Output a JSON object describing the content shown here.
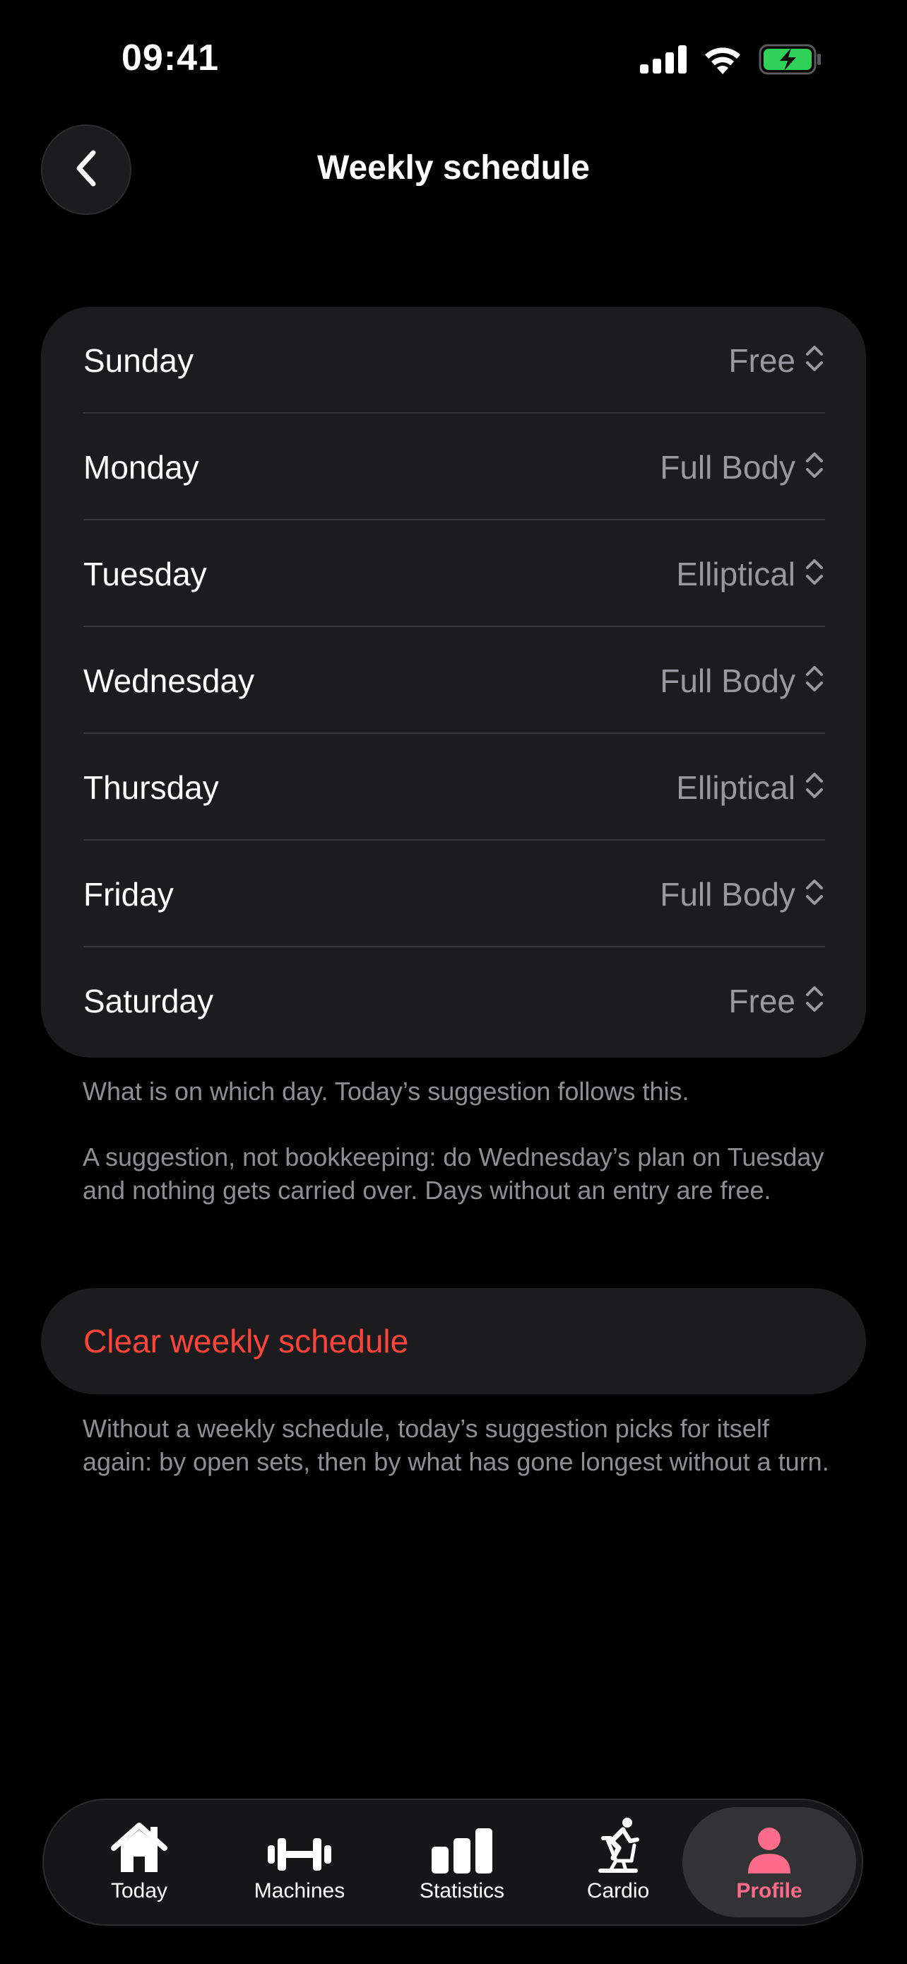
{
  "status_bar": {
    "time": "09:41",
    "icons": [
      "cellular-signal-icon",
      "wifi-icon",
      "battery-charging-icon"
    ]
  },
  "nav": {
    "back_icon": "chevron-left-icon",
    "title": "Weekly schedule"
  },
  "schedule": {
    "days": [
      {
        "day": "Sunday",
        "value": "Free"
      },
      {
        "day": "Monday",
        "value": "Full Body"
      },
      {
        "day": "Tuesday",
        "value": "Elliptical"
      },
      {
        "day": "Wednesday",
        "value": "Full Body"
      },
      {
        "day": "Thursday",
        "value": "Elliptical"
      },
      {
        "day": "Friday",
        "value": "Full Body"
      },
      {
        "day": "Saturday",
        "value": "Free"
      }
    ],
    "picker_icon": "chevron-up-down-icon"
  },
  "footnotes": {
    "note1": "What is on which day. Today’s suggestion follows this.",
    "note2": "A suggestion, not bookkeeping: do Wednesday’s plan on Tuesday and nothing gets carried over. Days without an entry are free.",
    "note3": "Without a weekly schedule, today’s suggestion picks for itself again: by open sets, then by what has gone longest without a turn."
  },
  "actions": {
    "clear_label": "Clear weekly schedule"
  },
  "tab_bar": {
    "tabs": [
      {
        "label": "Today",
        "icon": "house-icon"
      },
      {
        "label": "Machines",
        "icon": "dumbbell-icon"
      },
      {
        "label": "Statistics",
        "icon": "bar-chart-icon"
      },
      {
        "label": "Cardio",
        "icon": "stationary-bike-icon"
      },
      {
        "label": "Profile",
        "icon": "person-icon"
      }
    ],
    "active": "Profile"
  },
  "colors": {
    "background": "#000000",
    "card": "#1c1c1e",
    "secondary_text": "#98989f",
    "destructive": "#ff453a",
    "accent": "#ff6b8a",
    "battery_green": "#30d158"
  }
}
